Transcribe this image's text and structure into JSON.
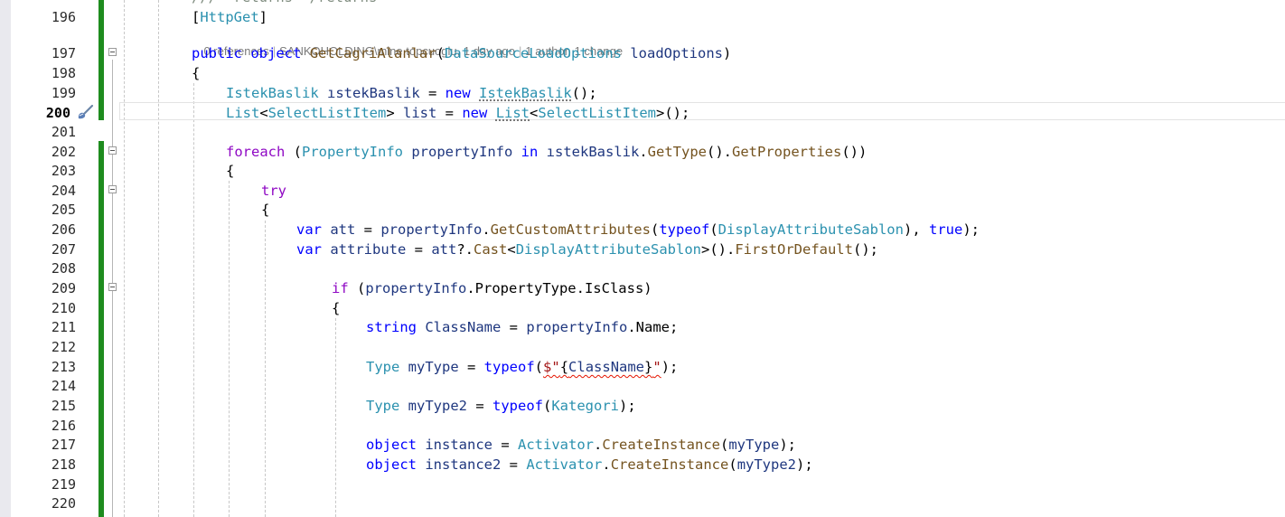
{
  "editor": {
    "top_partial_line": "///  returns  /returns",
    "codelens": {
      "references": "0 references",
      "author_change": "SANKOHOLDING\\mine.topcuoglu, 1 day ago",
      "authors": "1 author, 1 change",
      "separator": "|"
    },
    "line_numbers": {
      "l196": "196",
      "l197": "197",
      "l198": "198",
      "l199": "199",
      "l200": "200",
      "l201": "201",
      "l202": "202",
      "l203": "203",
      "l204": "204",
      "l205": "205",
      "l206": "206",
      "l207": "207",
      "l208": "208",
      "l209": "209",
      "l210": "210",
      "l211": "211",
      "l212": "212",
      "l213": "213",
      "l214": "214",
      "l215": "215",
      "l216": "216",
      "l217": "217",
      "l218": "218",
      "l219": "219",
      "l220": "220"
    },
    "code": {
      "l196": {
        "bracket_open": "[",
        "attr": "HttpGet",
        "bracket_close": "]"
      },
      "l197": {
        "kw1": "public",
        "kw2": "object",
        "method": "GetCagriAlanlar",
        "p1": "(",
        "type": "DataSourceLoadOptions",
        "param": "loadOptions",
        "p2": ")"
      },
      "l198": {
        "text": "{"
      },
      "l199": {
        "type1": "IstekBaslik",
        "var": "ıstekBaslik",
        "eq": " = ",
        "kw": "new",
        "type2": "IstekBaslik",
        "tail": "();"
      },
      "l200": {
        "type1": "List",
        "lt": "<",
        "type2": "SelectListItem",
        "gt": ">",
        "var": "list",
        "eq": " = ",
        "kw": "new",
        "type3": "List",
        "lt2": "<",
        "type4": "SelectListItem",
        "tail": ">();"
      },
      "l202": {
        "kw": "foreach",
        "p1": " (",
        "type": "PropertyInfo",
        "var": "propertyInfo",
        "kw2": "in",
        "obj": "ıstekBaslik",
        "dot1": ".",
        "m1": "GetType",
        "mid": "().",
        "m2": "GetProperties",
        "tail": "())"
      },
      "l203": {
        "text": "{"
      },
      "l204": {
        "kw": "try"
      },
      "l205": {
        "text": "{"
      },
      "l206": {
        "kw": "var",
        "var": "att",
        "eq": " = ",
        "obj": "propertyInfo",
        "dot": ".",
        "m": "GetCustomAttributes",
        "p1": "(",
        "kw2": "typeof",
        "p2": "(",
        "type": "DisplayAttributeSablon",
        "p3": "), ",
        "kw3": "true",
        "tail": ");"
      },
      "l207": {
        "kw": "var",
        "var": "attribute",
        "eq": " = ",
        "obj": "att",
        "q": "?.",
        "m1": "Cast",
        "lt": "<",
        "type": "DisplayAttributeSablon",
        "mid": ">().",
        "m2": "FirstOrDefault",
        "tail": "();"
      },
      "l209": {
        "kw": "if",
        "p1": " (",
        "obj": "propertyInfo",
        "rest": ".PropertyType.IsClass)"
      },
      "l210": {
        "text": "{"
      },
      "l211": {
        "kw": "string",
        "var": "ClassName",
        "eq": " = ",
        "obj": "propertyInfo",
        "rest": ".Name;"
      },
      "l213": {
        "type": "Type",
        "var": "myType",
        "eq": " = ",
        "kw": "typeof",
        "p1": "(",
        "str1": "$\"",
        "brace1": "{",
        "inner": "ClassName",
        "brace2": "}",
        "str2": "\"",
        "tail": ");"
      },
      "l215": {
        "type": "Type",
        "var": "myType2",
        "eq": " = ",
        "kw": "typeof",
        "p1": "(",
        "type2": "Kategori",
        "tail": ");"
      },
      "l217": {
        "kw": "object",
        "var": "instance",
        "eq": " = ",
        "type": "Activator",
        "dot": ".",
        "m": "CreateInstance",
        "p1": "(",
        "arg": "myType",
        "tail": ");"
      },
      "l218": {
        "kw": "object",
        "var": "instance2",
        "eq": " = ",
        "type": "Activator",
        "dot": ".",
        "m": "CreateInstance",
        "p1": "(",
        "arg": "myType2",
        "tail": ");"
      }
    },
    "colors": {
      "keyword": "#0000ff",
      "control_keyword": "#8f08c4",
      "type": "#2b91af",
      "method": "#74531f",
      "string": "#a31515",
      "local": "#1f377f",
      "change_bar": "#1e8c1e",
      "error_squiggle": "#e51400"
    },
    "icons": {
      "quick_action": "brush-icon",
      "fold": "collapse-icon"
    }
  }
}
